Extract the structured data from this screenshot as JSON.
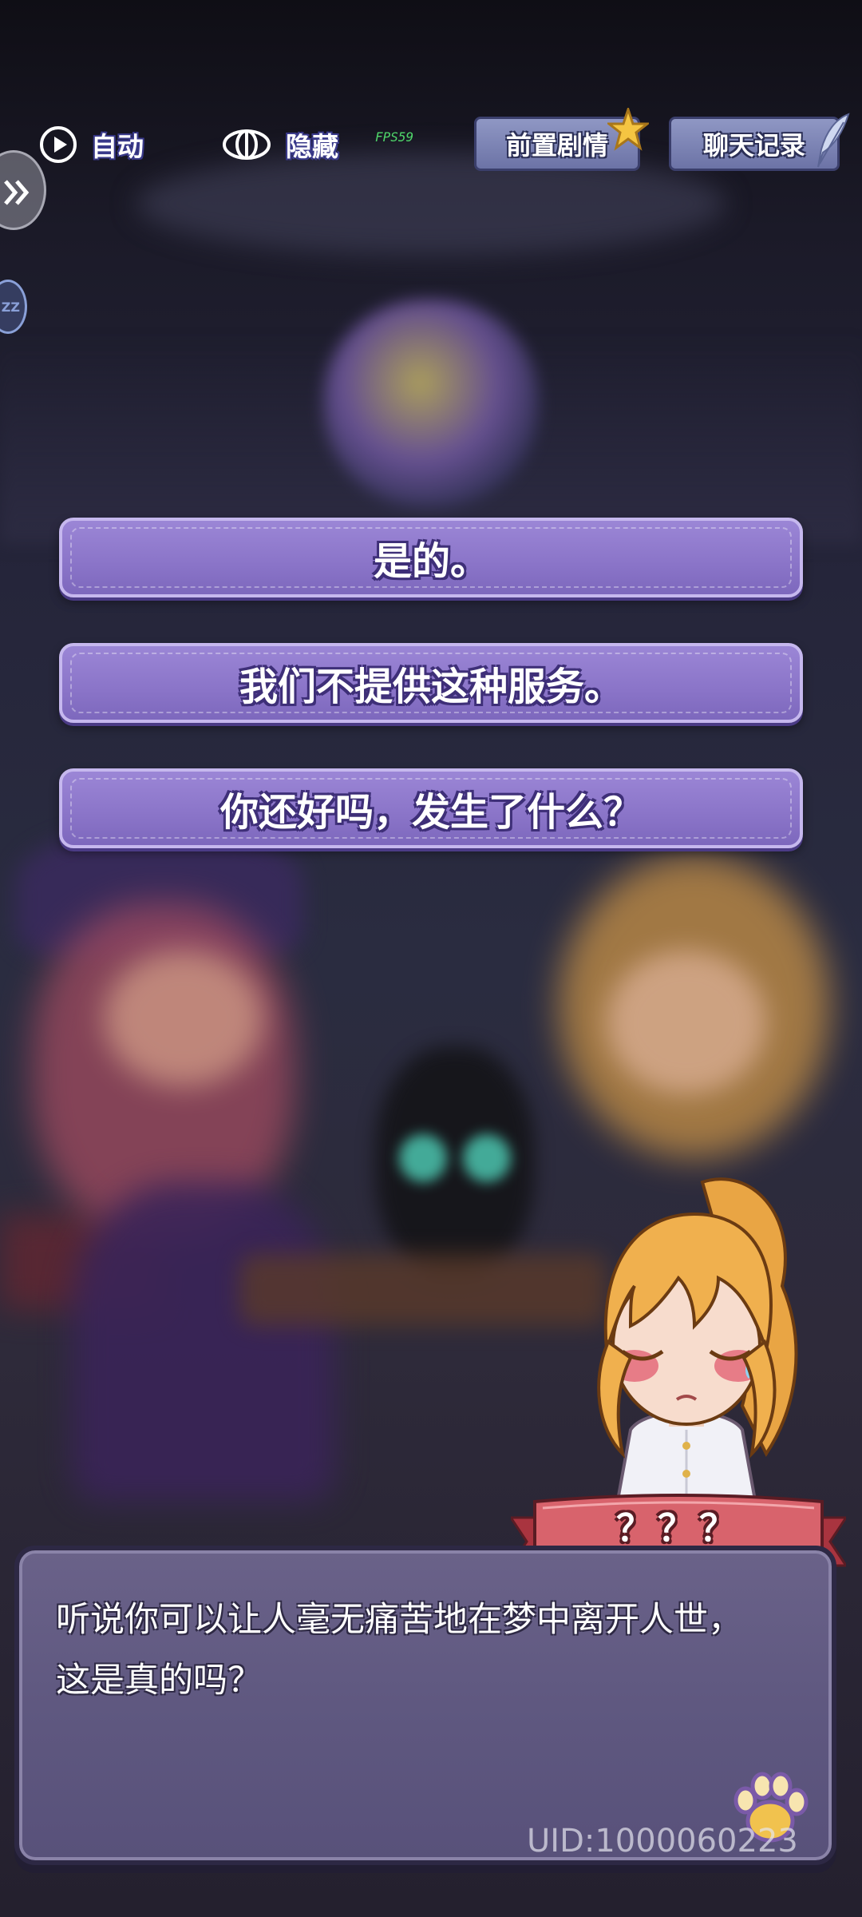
{
  "topbar": {
    "auto_label": "自动",
    "hide_label": "隐藏",
    "fps_text": "FPS59",
    "prologue_label": "前置剧情",
    "chatlog_label": "聊天记录"
  },
  "side": {
    "sleep_label": "ZZ"
  },
  "choices": [
    "是的。",
    "我们不提供这种服务。",
    "你还好吗，发生了什么？"
  ],
  "dialog": {
    "speaker": "？？？",
    "text": "听说你可以让人毫无痛苦地在梦中离开人世，这是真的吗？"
  },
  "uid_text": "UID:1000060223",
  "colors": {
    "choice_fill": "#8a74c8",
    "choice_border": "#c6b8ee",
    "dialog_fill": "#5f5880",
    "banner_red": "#c9525c",
    "top_button": "#7d85b8"
  }
}
